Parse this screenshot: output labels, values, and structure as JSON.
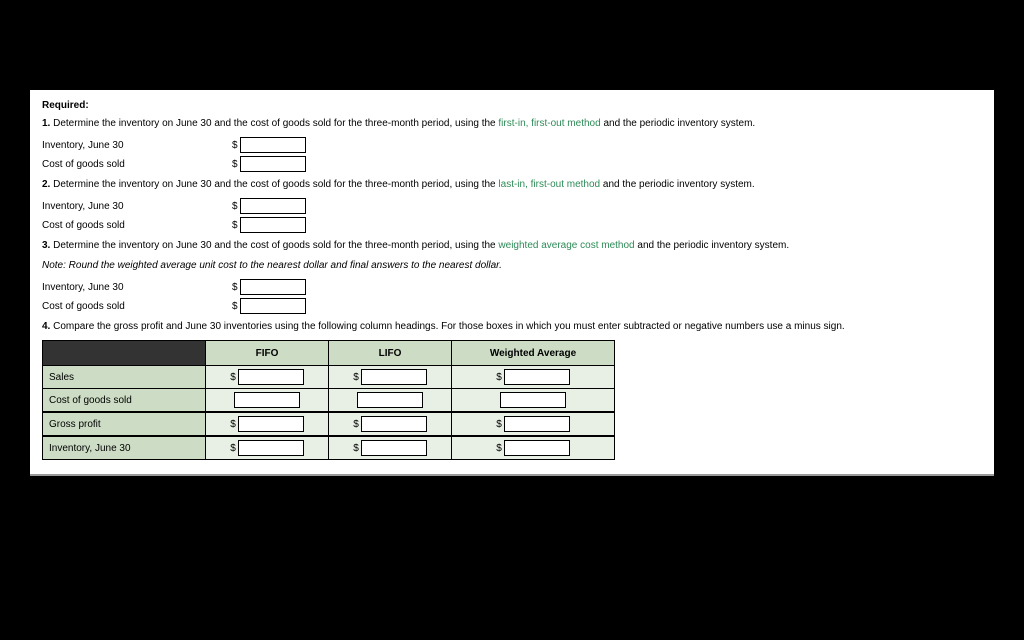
{
  "heading": "Required:",
  "q1": {
    "num": "1.",
    "pre": "Determine the inventory on June 30 and the cost of goods sold for the three-month period, using the ",
    "method": "first-in, first-out method",
    "post": " and the periodic inventory system.",
    "rows": [
      {
        "label": "Inventory, June 30"
      },
      {
        "label": "Cost of goods sold"
      }
    ]
  },
  "q2": {
    "num": "2.",
    "pre": "Determine the inventory on June 30 and the cost of goods sold for the three-month period, using the ",
    "method": "last-in, first-out method",
    "post": " and the periodic inventory system.",
    "rows": [
      {
        "label": "Inventory, June 30"
      },
      {
        "label": "Cost of goods sold"
      }
    ]
  },
  "q3": {
    "num": "3.",
    "pre": "Determine the inventory on June 30 and the cost of goods sold for the three-month period, using the ",
    "method": "weighted average cost method",
    "post": " and the periodic inventory system.",
    "note": "Note: Round the weighted average unit cost to the nearest dollar and final answers to the nearest dollar.",
    "rows": [
      {
        "label": "Inventory, June 30"
      },
      {
        "label": "Cost of goods sold"
      }
    ]
  },
  "q4": {
    "num": "4.",
    "text": "Compare the gross profit and June 30 inventories using the following column headings. For those boxes in which you must enter subtracted or negative numbers use a minus sign.",
    "cols": {
      "fifo": "FIFO",
      "lifo": "LIFO",
      "wavg": "Weighted Average"
    },
    "rows": {
      "sales": "Sales",
      "cogs": "Cost of goods sold",
      "gp": "Gross profit",
      "inv": "Inventory, June 30"
    }
  },
  "sym": {
    "dollar": "$"
  }
}
